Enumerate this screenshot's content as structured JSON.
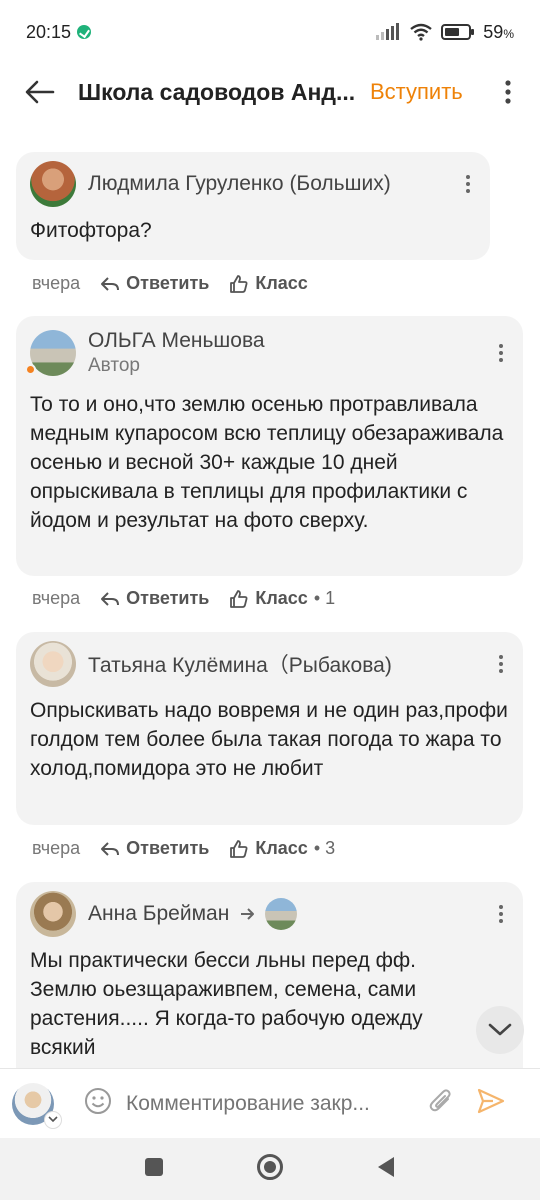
{
  "status": {
    "time": "20:15",
    "battery": "59",
    "battery_unit": "%"
  },
  "header": {
    "title": "Школа садоводов Анд...",
    "join_label": "Вступить"
  },
  "comments": [
    {
      "author": "Людмила Гуруленко (Больших)",
      "role": "",
      "text": "Фитофтора?",
      "time": "вчера",
      "reply_label": "Ответить",
      "like_label": "Класс",
      "likes": ""
    },
    {
      "author": "ОЛЬГА Меньшова",
      "role": "Автор",
      "text": "То то и оно,что землю осенью протравливала медным купаросом всю теплицу обезараживала осенью и весной 30+ каждые 10 дней опрыскивала в теплицы для профилактики с йодом и результат на фото сверху.",
      "time": "вчера",
      "reply_label": "Ответить",
      "like_label": "Класс",
      "likes": "1"
    },
    {
      "author": "Татьяна Кулёмина（Рыбакова)",
      "role": "",
      "text": "Опрыскивать надо вовремя и не один раз,профи голдом тем более была такая погода то жара то холод,помидора это не любит",
      "time": "вчера",
      "reply_label": "Ответить",
      "like_label": "Класс",
      "likes": "3"
    },
    {
      "author": "Анна Брейман",
      "role": "",
      "text": "Мы практически бесси льны перед фф. Землю оьезщаражи­впем, семена, сами растения..... Я когда-то рабочую одежду всякий",
      "time": "",
      "reply_label": "",
      "like_label": "",
      "likes": ""
    }
  ],
  "composer": {
    "placeholder": "Комментирование закр..."
  },
  "colors": {
    "accent": "#ee8208",
    "card": "#f3f3f3",
    "online": "#f58220",
    "navbar": "#f2f2f2"
  },
  "icons": {
    "back": "arrow-left-icon",
    "menu": "vertical-dots-icon",
    "reply": "reply-arrow-icon",
    "like": "thumbs-up-icon",
    "smile": "smile-icon",
    "attach": "paperclip-icon",
    "send": "send-icon",
    "scroll": "chevron-down-icon"
  }
}
